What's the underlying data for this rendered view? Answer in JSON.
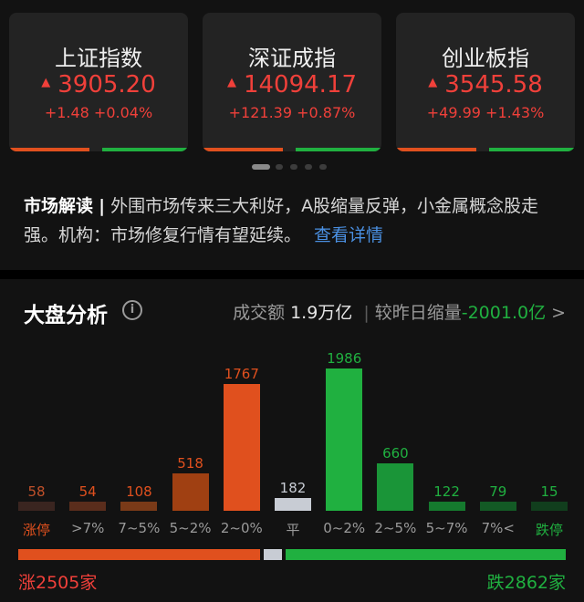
{
  "indices": [
    {
      "name": "上证指数",
      "price": "3905.20",
      "change": "+1.48 +0.04%"
    },
    {
      "name": "深证成指",
      "price": "14094.17",
      "change": "+121.39 +0.87%"
    },
    {
      "name": "创业板指",
      "price": "3545.58",
      "change": "+49.99 +1.43%"
    }
  ],
  "carousel": {
    "count": 5,
    "active": 0
  },
  "interpretation": {
    "label": "市场解读",
    "separator": "|",
    "text": "外围市场传来三大利好，A股缩量反弹，小金属概念股走强。机构：市场修复行情有望延续。",
    "link": "查看详情"
  },
  "analysis": {
    "title": "大盘分析",
    "info_icon": "info-icon",
    "turnover_label": "成交额",
    "turnover_value": "1.9万亿",
    "separator": "|",
    "compare_label": "较昨日缩量",
    "compare_value": "-2001.0亿",
    "chevron": ">"
  },
  "chart_data": {
    "type": "bar",
    "categories": [
      "涨停",
      ">7%",
      "7~5%",
      "5~2%",
      "2~0%",
      "平",
      "0~2%",
      "2~5%",
      "5~7%",
      "7%<",
      "跌停"
    ],
    "values": [
      58,
      54,
      108,
      518,
      1767,
      182,
      1986,
      660,
      122,
      79,
      15
    ],
    "colors": [
      "#3a2520",
      "#5a2d1c",
      "#7a3a18",
      "#a04012",
      "#e0501e",
      "#c8ccd4",
      "#20b040",
      "#1a9538",
      "#157a2e",
      "#135a25",
      "#113e1d"
    ],
    "category_colors": [
      "#e0501e",
      "#9a9a9a",
      "#9a9a9a",
      "#9a9a9a",
      "#9a9a9a",
      "#9a9a9a",
      "#9a9a9a",
      "#9a9a9a",
      "#9a9a9a",
      "#9a9a9a",
      "#20b040"
    ]
  },
  "summary": {
    "up_label": "涨2505家",
    "down_label": "跌2862家",
    "up": 2505,
    "flat": 182,
    "down": 2862
  },
  "colors": {
    "rise": "#f0403a",
    "fall": "#20b040",
    "accent": "#4a90e2"
  }
}
